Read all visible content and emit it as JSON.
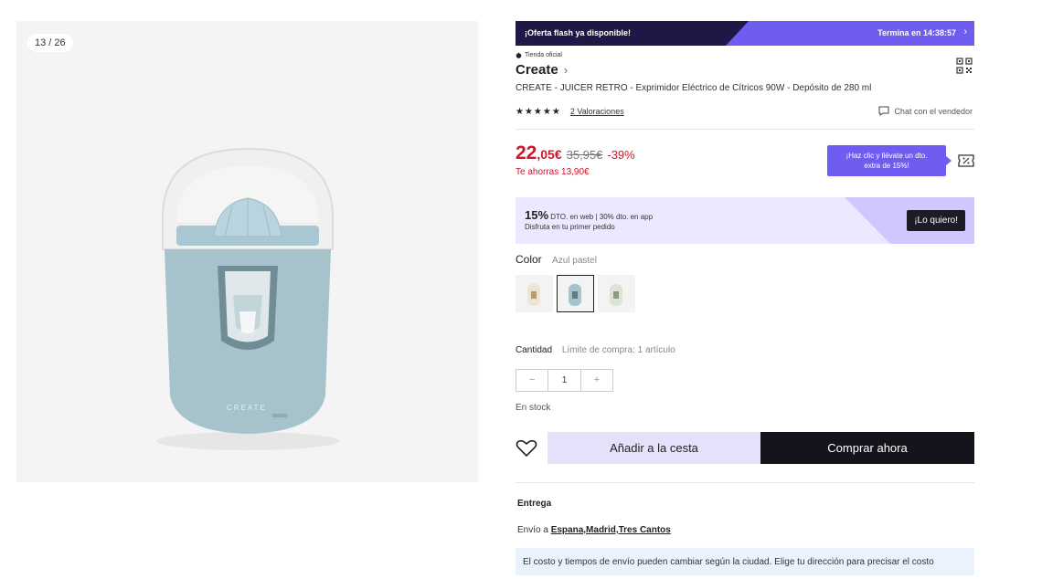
{
  "gallery": {
    "counter": "13 / 26",
    "brand_on_product": "CREATE"
  },
  "flash": {
    "label": "¡Oferta flash ya disponible!",
    "countdown": "Termina en 14:38:57",
    "chevron": "›"
  },
  "store": {
    "badge": "Tienda oficial",
    "name": "Create",
    "chevron": "›"
  },
  "product": {
    "title": "CREATE - JUICER RETRO - Exprimidor Eléctrico de Cítricos 90W - Depósito de 280 ml",
    "stars": "★★★★★",
    "reviews": "2 Valoraciones",
    "chat": "Chat con el vendedor"
  },
  "price": {
    "main": "22",
    "decimals": ",05€",
    "old": "35,95€",
    "discount": "-39%",
    "savings": "Te ahorras 13,90€",
    "promo_line1": "¡Haz clic y llévate un dto.",
    "promo_line2": "extra de 15%!"
  },
  "banner": {
    "big": "15%",
    "dto_web": " DTO. en web",
    "sep": " | ",
    "app": "30% dto. en app",
    "sub": "Disfruta en tu primer pedido",
    "cta": "¡Lo quiero!"
  },
  "color": {
    "label": "Color",
    "selected": "Azul pastel",
    "options": [
      "crema",
      "azul",
      "verde"
    ]
  },
  "quantity": {
    "label": "Cantidad",
    "limit": "Límite de compra: 1 artículo",
    "minus": "−",
    "value": "1",
    "plus": "+"
  },
  "stock": "En stock",
  "actions": {
    "add": "Añadir a la cesta",
    "buy": "Comprar ahora"
  },
  "delivery": {
    "heading": "Entrega",
    "prefix": "Envío a ",
    "location": "Espana,Madrid,Tres Cantos",
    "info": "El costo y tiempos de envío pueden cambiar según la ciudad. Elige tu dirección para precisar el costo"
  },
  "colors": {
    "accent": "#6e5df0",
    "price_red": "#d0142c",
    "dark": "#14141c",
    "lavender": "#e4e1fb",
    "flash_dark": "#1f1746"
  }
}
